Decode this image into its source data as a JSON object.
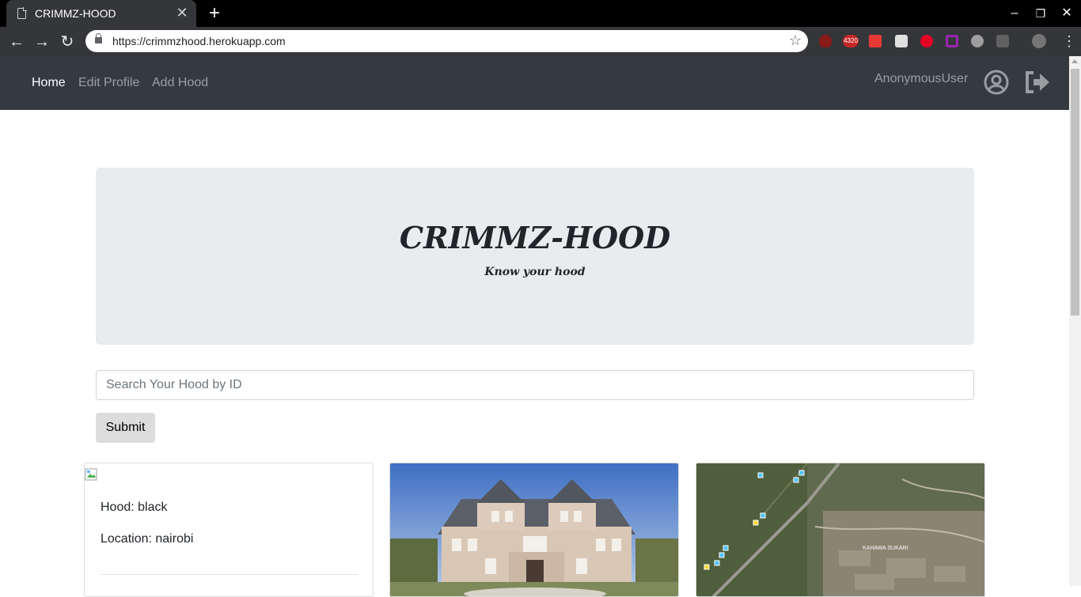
{
  "browser": {
    "tab_title": "CRIMMZ-HOOD",
    "tab_close": "✕",
    "new_tab": "+",
    "url": "https://crimmzhood.herokuapp.com",
    "back": "←",
    "forward": "→",
    "reload": "↻",
    "star": "☆",
    "minimize": "–",
    "maximize": "❐",
    "close": "✕",
    "extensions": [
      {
        "name": "ublock-icon",
        "color": "#8b1a1a"
      },
      {
        "name": "counter-icon",
        "color": "#c62828",
        "label": "4320"
      },
      {
        "name": "video-icon",
        "color": "#e53935"
      },
      {
        "name": "tiles-icon",
        "color": "#e0e0e0"
      },
      {
        "name": "pinterest-icon",
        "color": "#e60023"
      },
      {
        "name": "purple-square-icon",
        "color": "#9c27b0"
      },
      {
        "name": "cloud-icon",
        "color": "#9e9e9e"
      },
      {
        "name": "box-icon",
        "color": "#616161"
      }
    ]
  },
  "navbar": {
    "links": [
      "Home",
      "Edit Profile",
      "Add Hood"
    ],
    "user": "AnonymousUser"
  },
  "jumbotron": {
    "title": "CRIMMZ-HOOD",
    "subtitle": "Know your hood"
  },
  "search": {
    "placeholder": "Search Your Hood by ID",
    "submit_label": "Submit"
  },
  "cards": [
    {
      "hood_line": "Hood: black",
      "location_line": "Location: nairobi"
    },
    {
      "image": "house-photo"
    },
    {
      "image": "map-photo",
      "map_label": "KAHAWA SUKARI"
    }
  ]
}
